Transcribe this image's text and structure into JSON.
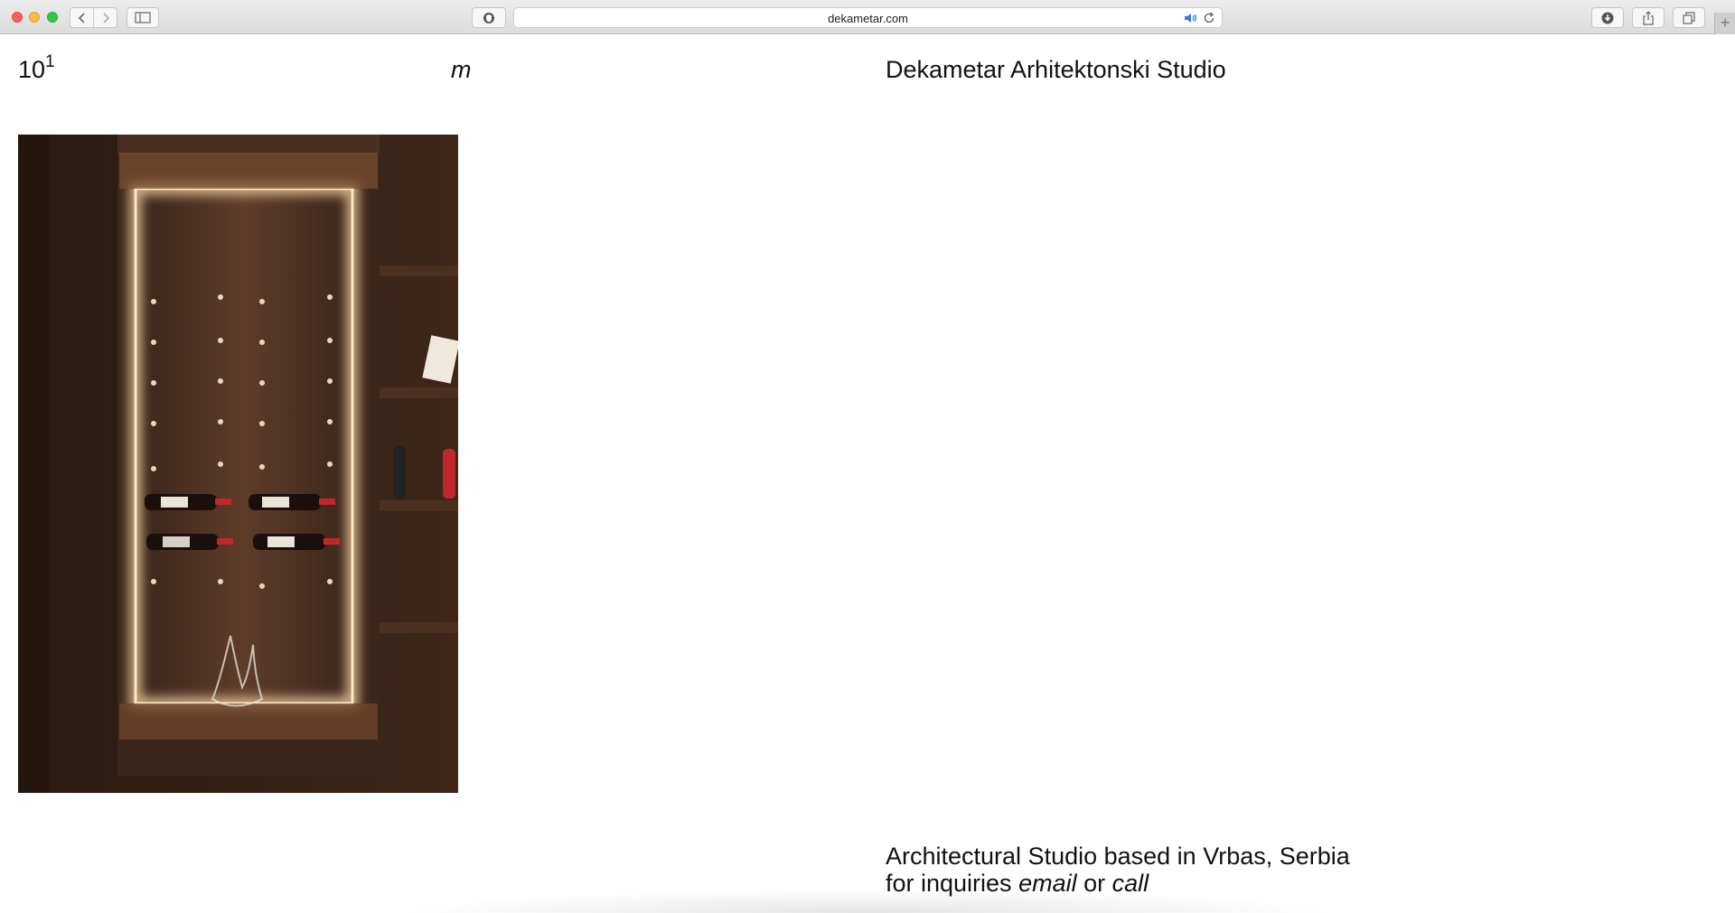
{
  "browser": {
    "url": "dekametar.com",
    "new_tab_symbol": "+"
  },
  "header": {
    "logo_base": "10",
    "logo_exponent": "1",
    "unit": "m",
    "title": "Dekametar Arhitektonski Studio"
  },
  "hero": {
    "image_subject": "illuminated wooden wine cabinet with bottles and decanter",
    "image_alt": "Wine cabinet interior"
  },
  "footer": {
    "tagline": "Architectural Studio based in Vrbas, Serbia",
    "inquiry_prefix": "for inquiries ",
    "email_label": "email",
    "or_label": " or ",
    "call_label": "call"
  },
  "colors": {
    "wood_dark": "#2a1a12",
    "wood_mid": "#5a3a28",
    "led_glow": "#f5d3a3",
    "wine_red": "#c0272d"
  }
}
